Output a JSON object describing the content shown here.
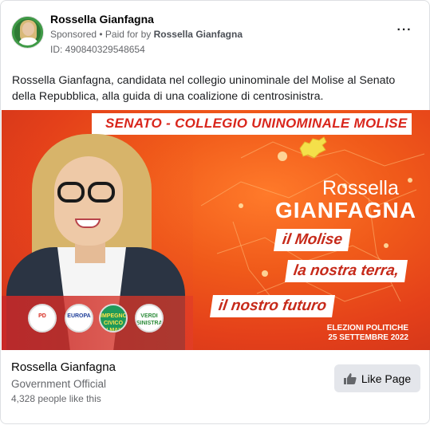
{
  "post": {
    "author_name": "Rossella Gianfagna",
    "sponsored_label": "Sponsored",
    "paid_prefix": " • Paid for by ",
    "paid_by": "Rossella Gianfagna",
    "ad_id": "ID: 490840329548654",
    "more_icon": "more-options-icon",
    "body_text": "Rossella Gianfagna, candidata nel collegio uninominale del Molise al Senato della Repubblica, alla guida di una coalizione di centrosinistra."
  },
  "creative": {
    "banner": "SENATO - COLLEGIO UNINOMINALE MOLISE",
    "first_name": "Rossella",
    "last_name": "GIANFAGNA",
    "tagline_1": "il Molise",
    "tagline_2": "la nostra terra,",
    "tagline_3": "il nostro futuro",
    "election_line_1": "ELEZIONI POLITICHE",
    "election_line_2": "25 SETTEMBRE 2022",
    "logos": [
      {
        "text": "PD"
      },
      {
        "text": "EUROPA"
      },
      {
        "text": "IMPEGNO CIVICO DI MAIO"
      },
      {
        "text": "VERDI SINISTRA"
      }
    ],
    "colors": {
      "background": "#e4401a",
      "accent": "#c62a1a",
      "banner_text": "#d9261c"
    }
  },
  "footer": {
    "page_name": "Rossella Gianfagna",
    "category": "Government Official",
    "likes": "4,328 people like this",
    "like_button_label": "Like Page",
    "like_icon": "thumbs-up-icon"
  }
}
